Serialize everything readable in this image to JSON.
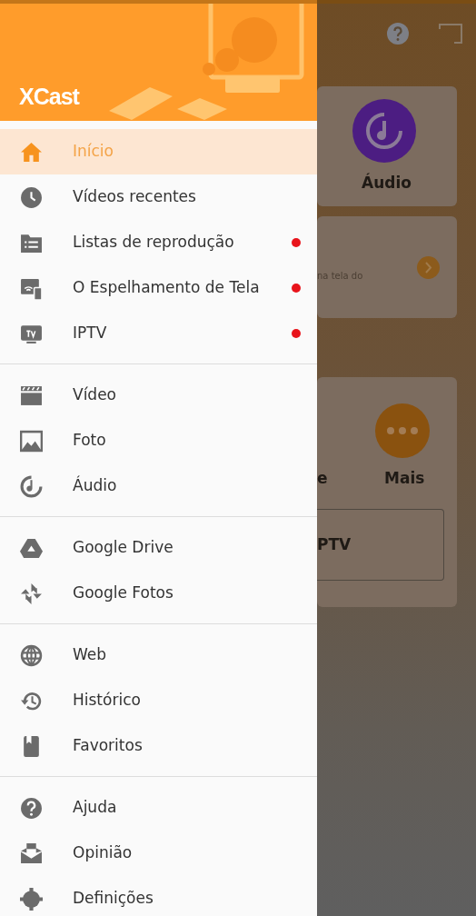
{
  "drawer": {
    "logo": "XCast",
    "groups": [
      {
        "items": [
          {
            "label": "Início",
            "kind": "home",
            "selected": true,
            "dot": false
          },
          {
            "label": "Vídeos recentes",
            "kind": "clock",
            "selected": false,
            "dot": false
          },
          {
            "label": "Listas de reprodução",
            "kind": "playlist",
            "selected": false,
            "dot": true
          },
          {
            "label": "O Espelhamento de Tela",
            "kind": "mirror",
            "selected": false,
            "dot": true
          },
          {
            "label": "IPTV",
            "kind": "tv",
            "selected": false,
            "dot": true
          }
        ]
      },
      {
        "items": [
          {
            "label": "Vídeo",
            "kind": "clapper",
            "selected": false,
            "dot": false
          },
          {
            "label": "Foto",
            "kind": "image",
            "selected": false,
            "dot": false
          },
          {
            "label": "Áudio",
            "kind": "music",
            "selected": false,
            "dot": false
          }
        ]
      },
      {
        "items": [
          {
            "label": "Google Drive",
            "kind": "drive",
            "selected": false,
            "dot": false
          },
          {
            "label": "Google Fotos",
            "kind": "pinwheel",
            "selected": false,
            "dot": false
          }
        ]
      },
      {
        "items": [
          {
            "label": "Web",
            "kind": "globe",
            "selected": false,
            "dot": false
          },
          {
            "label": "Histórico",
            "kind": "history",
            "selected": false,
            "dot": false
          },
          {
            "label": "Favoritos",
            "kind": "bookmark",
            "selected": false,
            "dot": false
          }
        ]
      },
      {
        "items": [
          {
            "label": "Ajuda",
            "kind": "help",
            "selected": false,
            "dot": false
          },
          {
            "label": "Opinião",
            "kind": "feedback",
            "selected": false,
            "dot": false
          },
          {
            "label": "Definições",
            "kind": "gear",
            "selected": false,
            "dot": false
          }
        ]
      }
    ]
  },
  "background": {
    "audio_label": "Áudio",
    "mirror_text": "na tela do",
    "partial_label": "e",
    "more_label": "Mais",
    "iptv_button": "PTV"
  }
}
